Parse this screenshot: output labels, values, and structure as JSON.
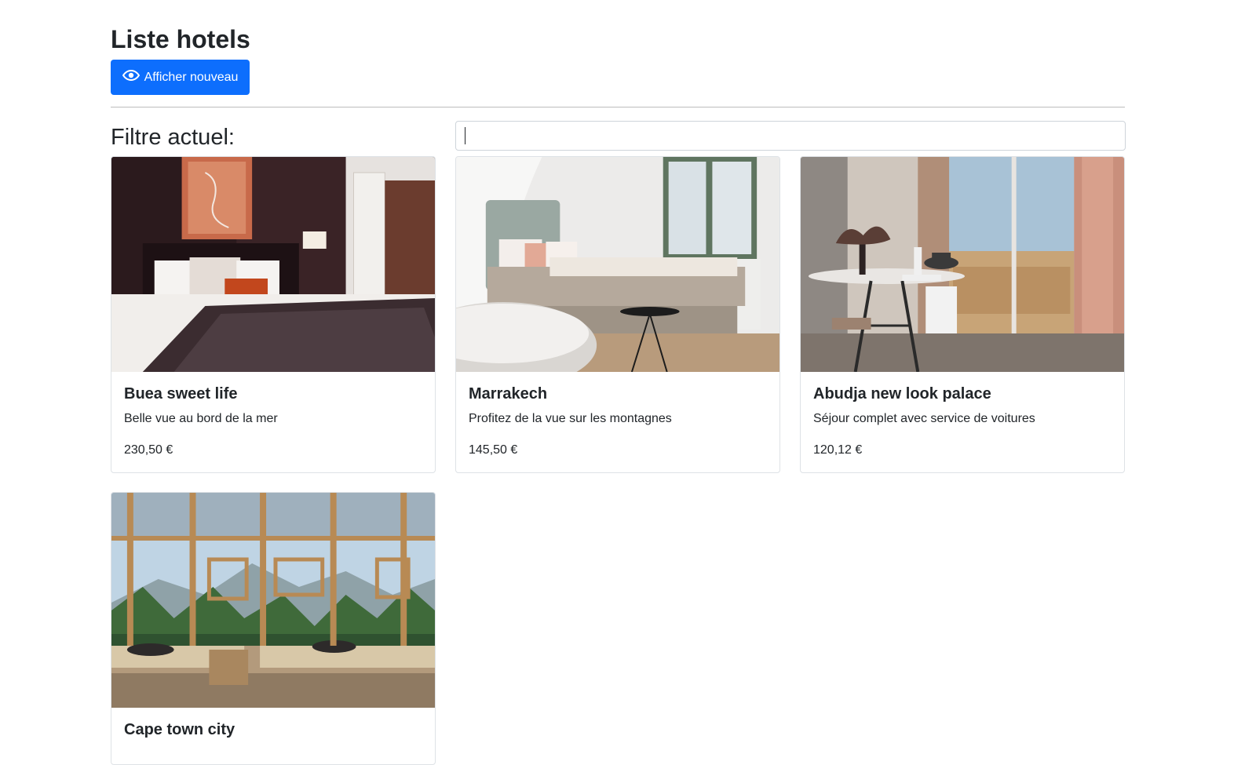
{
  "header": {
    "title": "Liste hotels",
    "button_label": "Afficher nouveau",
    "button_icon": "eye-icon",
    "accent_color": "#0d6efd"
  },
  "filter": {
    "label": "Filtre actuel:",
    "value": "",
    "placeholder": ""
  },
  "hotels": [
    {
      "name": "Buea sweet life",
      "description": "Belle vue au bord de la mer",
      "price": "230,50 €",
      "image": "bedroom-photo"
    },
    {
      "name": "Marrakech",
      "description": "Profitez de la vue sur les montagnes",
      "price": "145,50 €",
      "image": "bedroom-bath-photo"
    },
    {
      "name": "Abudja new look palace",
      "description": "Séjour complet avec service de voitures",
      "price": "120,12 €",
      "image": "dining-terrace-photo"
    },
    {
      "name": "Cape town city",
      "description": "",
      "price": "",
      "image": "glass-room-forest-photo"
    }
  ]
}
